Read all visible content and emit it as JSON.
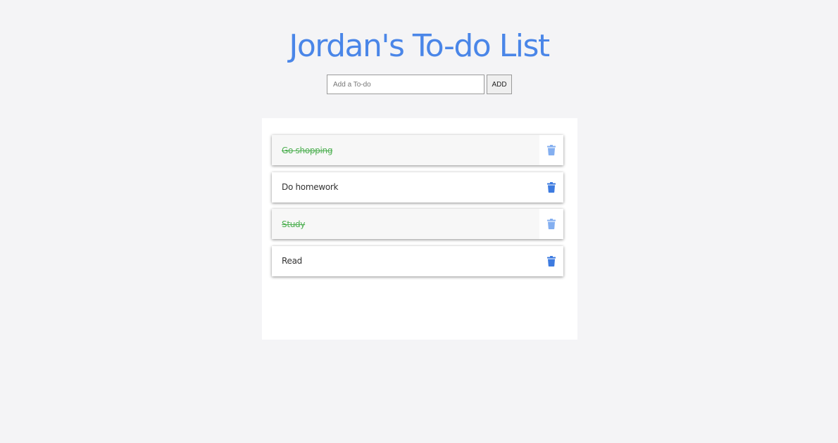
{
  "header": {
    "title": "Jordan's To-do List"
  },
  "add_form": {
    "placeholder": "Add a To-do",
    "value": "",
    "button_label": "ADD"
  },
  "todos": [
    {
      "text": "Go shopping",
      "completed": true
    },
    {
      "text": "Do homework",
      "completed": false
    },
    {
      "text": "Study",
      "completed": true
    },
    {
      "text": "Read",
      "completed": false
    }
  ],
  "colors": {
    "accent": "#4a86e8",
    "completed_text": "#4caf50",
    "delete_icon": "#3d7be0",
    "delete_icon_completed": "#5b95ec"
  },
  "icons": {
    "delete": "trash-icon"
  }
}
